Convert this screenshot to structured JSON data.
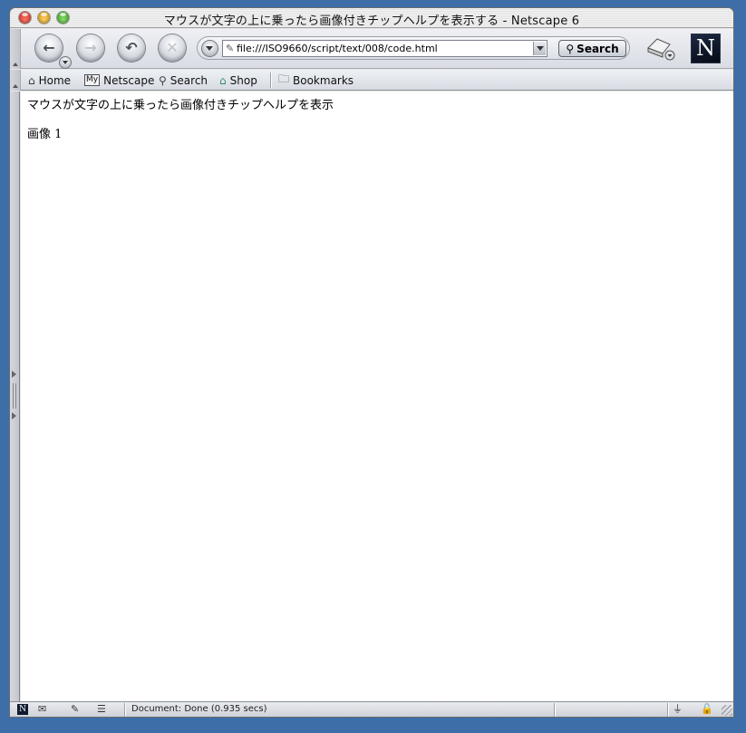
{
  "window": {
    "title": "マウスが文字の上に乗ったら画像付きチップヘルプを表示する - Netscape 6"
  },
  "navbar": {
    "back_icon": "back-arrow",
    "forward_icon": "forward-arrow",
    "reload_icon": "reload",
    "stop_icon": "stop",
    "url": "file:///ISO9660/script/text/008/code.html",
    "search_label": "Search"
  },
  "personal_toolbar": {
    "items": [
      {
        "label": "Home",
        "icon": "home-icon"
      },
      {
        "label": "Netscape",
        "icon": "my-netscape-icon",
        "badge": "My"
      },
      {
        "label": "Search",
        "icon": "search-icon"
      },
      {
        "label": "Shop",
        "icon": "shop-icon"
      },
      {
        "label": "Bookmarks",
        "icon": "folder-icon"
      }
    ]
  },
  "page": {
    "line1": "マウスが文字の上に乗ったら画像付きチップヘルプを表示",
    "line2": "画像 1"
  },
  "statusbar": {
    "text": "Document: Done (0.935 secs)"
  },
  "logo": {
    "letter": "N"
  }
}
